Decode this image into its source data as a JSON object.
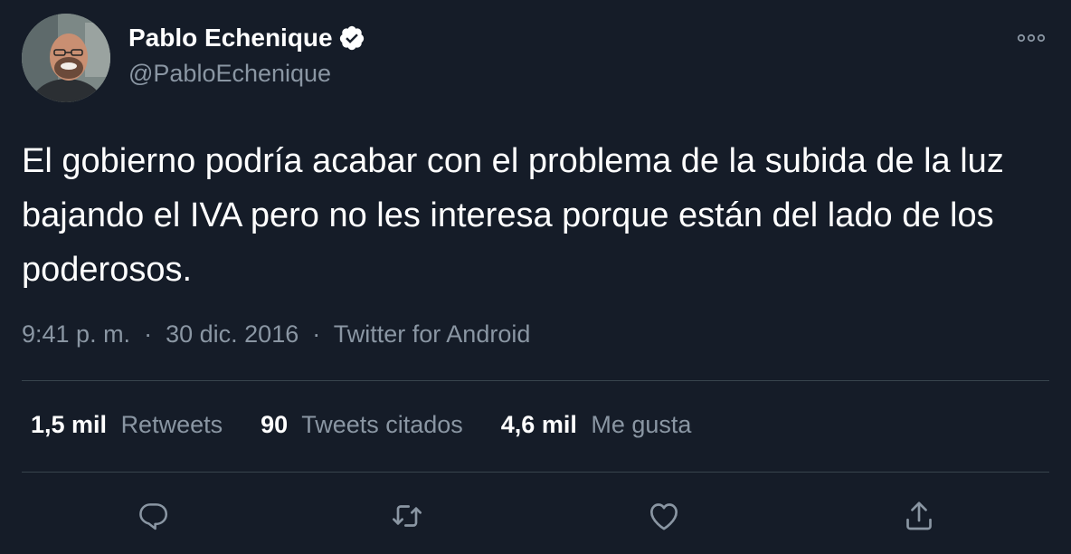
{
  "author": {
    "name": "Pablo Echenique",
    "handle": "@PabloEchenique",
    "verified": true
  },
  "tweet": {
    "text": "El gobierno podría acabar con el problema de la subida de la luz bajando el IVA pero no les interesa porque están del lado de los poderosos.",
    "time": "9:41 p. m.",
    "date": "30 dic. 2016",
    "source": "Twitter for Android",
    "separator": "·"
  },
  "stats": [
    {
      "count": "1,5 mil",
      "label": "Retweets"
    },
    {
      "count": "90",
      "label": "Tweets citados"
    },
    {
      "count": "4,6 mil",
      "label": "Me gusta"
    }
  ],
  "icons": {
    "reply": "reply-icon",
    "retweet": "retweet-icon",
    "like": "heart-icon",
    "share": "share-icon",
    "more": "more-options-icon",
    "verified": "verified-badge-icon"
  },
  "colors": {
    "background": "#151c28",
    "text_primary": "#ffffff",
    "text_secondary": "#8a96a3",
    "divider": "#38444d"
  }
}
